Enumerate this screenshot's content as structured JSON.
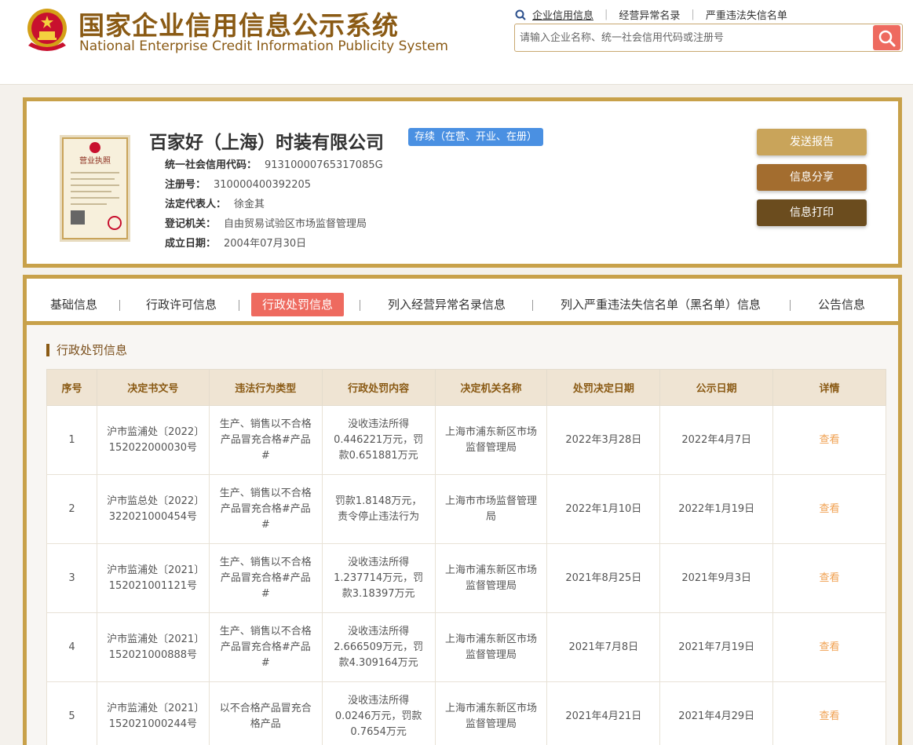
{
  "header": {
    "title_cn": "国家企业信用信息公示系统",
    "title_en": "National Enterprise Credit Information Publicity System",
    "nav": [
      {
        "label": "企业信用信息",
        "active": true
      },
      {
        "label": "经营异常名录",
        "active": false
      },
      {
        "label": "严重违法失信名单",
        "active": false
      }
    ],
    "search_placeholder": "请输入企业名称、统一社会信用代码或注册号"
  },
  "company": {
    "name": "百家好（上海）时装有限公司",
    "status": "存续（在营、开业、在册）",
    "fields": [
      {
        "label": "统一社会信用代码：",
        "value": "91310000765317085G"
      },
      {
        "label": "注册号：",
        "value": "310000400392205"
      },
      {
        "label": "法定代表人：",
        "value": "徐金其"
      },
      {
        "label": "登记机关：",
        "value": "自由贸易试验区市场监督管理局"
      },
      {
        "label": "成立日期：",
        "value": "2004年07月30日"
      }
    ],
    "license_title": "营业执照",
    "buttons": {
      "report": "发送报告",
      "share": "信息分享",
      "print": "信息打印"
    }
  },
  "tabs": [
    {
      "label": "基础信息",
      "active": false
    },
    {
      "label": "行政许可信息",
      "active": false
    },
    {
      "label": "行政处罚信息",
      "active": true
    },
    {
      "label": "列入经营异常名录信息",
      "active": false
    },
    {
      "label": "列入严重违法失信名单（黑名单）信息",
      "active": false
    },
    {
      "label": "公告信息",
      "active": false
    }
  ],
  "section_title": "行政处罚信息",
  "table": {
    "headers": [
      "序号",
      "决定书文号",
      "违法行为类型",
      "行政处罚内容",
      "决定机关名称",
      "处罚决定日期",
      "公示日期",
      "详情"
    ],
    "rows": [
      [
        "1",
        "沪市监浦处〔2022〕152022000030号",
        "生产、销售以不合格产品冒充合格#产品#",
        "没收违法所得0.446221万元，罚款0.651881万元",
        "上海市浦东新区市场监督管理局",
        "2022年3月28日",
        "2022年4月7日",
        "查看"
      ],
      [
        "2",
        "沪市监总处〔2022〕322021000454号",
        "生产、销售以不合格产品冒充合格#产品#",
        "罚款1.8148万元，责令停止违法行为",
        "上海市市场监督管理局",
        "2022年1月10日",
        "2022年1月19日",
        "查看"
      ],
      [
        "3",
        "沪市监浦处〔2021〕152021001121号",
        "生产、销售以不合格产品冒充合格#产品#",
        "没收违法所得1.237714万元，罚款3.18397万元",
        "上海市浦东新区市场监督管理局",
        "2021年8月25日",
        "2021年9月3日",
        "查看"
      ],
      [
        "4",
        "沪市监浦处〔2021〕152021000888号",
        "生产、销售以不合格产品冒充合格#产品#",
        "没收违法所得2.666509万元，罚款4.309164万元",
        "上海市浦东新区市场监督管理局",
        "2021年7月8日",
        "2021年7月19日",
        "查看"
      ],
      [
        "5",
        "沪市监浦处〔2021〕152021000244号",
        "以不合格产品冒充合格产品",
        "没收违法所得0.0246万元，罚款0.7654万元",
        "上海市浦东新区市场监督管理局",
        "2021年4月21日",
        "2021年4月29日",
        "查看"
      ]
    ]
  },
  "colors": {
    "gold_border": "#c8a14a",
    "brown_title": "#8a5a14",
    "active_tab": "#ee6a5f",
    "status_badge": "#4a90e2",
    "view_link": "#f0a050"
  },
  "icons": [
    "national-emblem-icon",
    "search-icon",
    "business-license-image"
  ]
}
